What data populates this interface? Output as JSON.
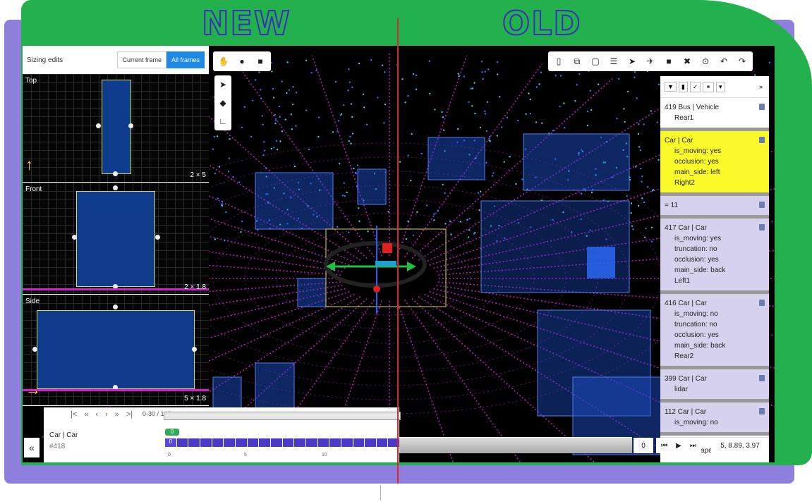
{
  "headers": {
    "new": "NEW",
    "old": "OLD"
  },
  "sizing": {
    "title": "Sizing edits",
    "toggle": [
      "Current frame",
      "All frames"
    ],
    "views": [
      {
        "label": "Top",
        "dims": "2 × 5"
      },
      {
        "label": "Front",
        "dims": "2 × 1.8"
      },
      {
        "label": "Side",
        "dims": "5 × 1.8"
      }
    ]
  },
  "timeline": {
    "range": "0-30 / 149",
    "object_label": "Car | Car",
    "object_id": "#418",
    "badge": "0",
    "first_cell": "0",
    "ticks": [
      "0",
      "5",
      "10"
    ],
    "collapse": "«"
  },
  "objects": [
    {
      "title": "419 Bus | Vehicle",
      "lines": [
        "Rear1"
      ],
      "bg": "#ffffff"
    },
    {
      "title": "Car | Car",
      "lines": [
        "is_moving: yes",
        "occlusion: yes",
        "main_side: left",
        "Right2"
      ],
      "bg": "#fafa2a"
    },
    {
      "title": "= 11",
      "lines": [],
      "bg": "#d6d2ee"
    },
    {
      "title": "417 Car | Car",
      "lines": [
        "is_moving: yes",
        "truncation: no",
        "occlusion: yes",
        "main_side: back",
        "Left1"
      ],
      "bg": "#d6d2ee"
    },
    {
      "title": "416 Car | Car",
      "lines": [
        "is_moving: no",
        "truncation: no",
        "occlusion: yes",
        "main_side: back",
        "Rear2"
      ],
      "bg": "#d6d2ee"
    },
    {
      "title": "399 Car | Car",
      "lines": [
        "lidar"
      ],
      "bg": "#d6d2ee"
    },
    {
      "title": "112 Car | Car",
      "lines": [
        "is_moving: no"
      ],
      "bg": "#d6d2ee"
    }
  ],
  "shapes_count": "Shapes: 1/127",
  "frame_input": "0",
  "coords": "5, 8.89, 3.97",
  "colors": {
    "frame": "#22b14c",
    "shadow": "#8f7fdd",
    "box": "#0f3b8c",
    "lidar": "#e020e0",
    "track": "#4b39c8"
  }
}
